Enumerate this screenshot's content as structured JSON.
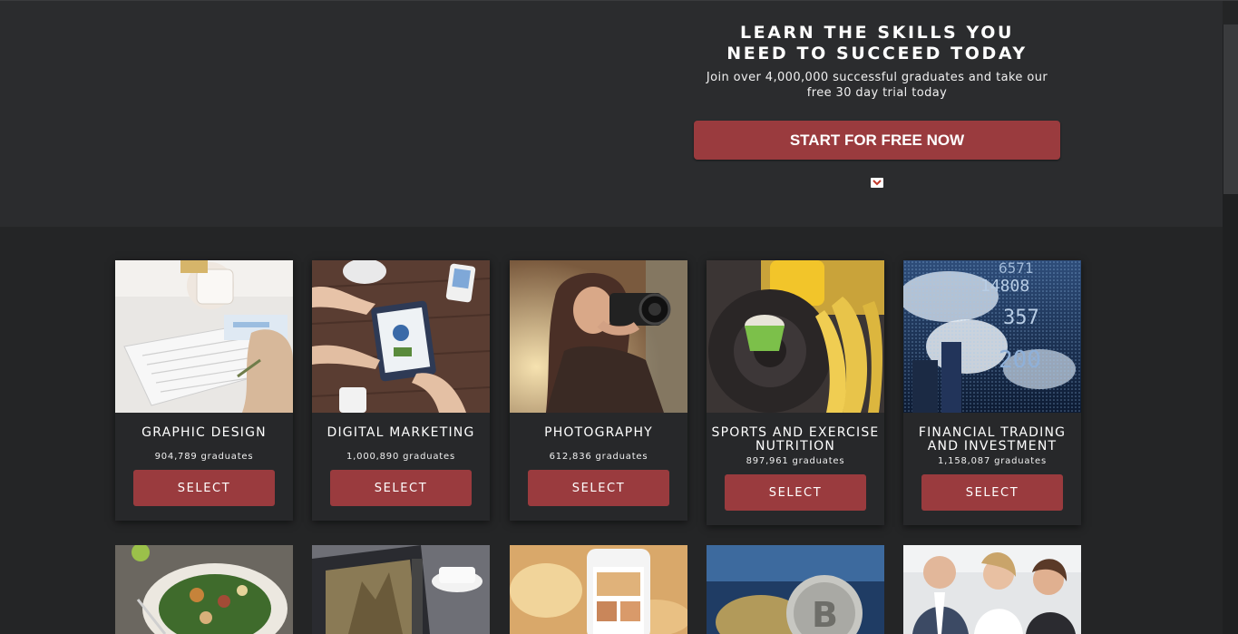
{
  "hero": {
    "title_line1": "LEARN THE SKILLS YOU",
    "title_line2": "NEED TO SUCCEED TODAY",
    "sub_line1": "Join over 4,000,000 successful graduates and take our",
    "sub_line2": "free 30 day trial today",
    "cta_label": "START FOR FREE NOW",
    "scroll_icon": "chevron-down-icon"
  },
  "colors": {
    "accent": "#9a3b3e",
    "page_bg": "#242526",
    "hero_bg": "#2b2c2e",
    "card_bg": "#27282a"
  },
  "courses": [
    {
      "title_line1": "GRAPHIC DESIGN",
      "title_line2": "",
      "graduates": "904,789 graduates",
      "select_label": "SELECT"
    },
    {
      "title_line1": "DIGITAL MARKETING",
      "title_line2": "",
      "graduates": "1,000,890 graduates",
      "select_label": "SELECT"
    },
    {
      "title_line1": "PHOTOGRAPHY",
      "title_line2": "",
      "graduates": "612,836 graduates",
      "select_label": "SELECT"
    },
    {
      "title_line1": "SPORTS AND EXERCISE",
      "title_line2": "NUTRITION",
      "graduates": "897,961 graduates",
      "select_label": "SELECT"
    },
    {
      "title_line1": "FINANCIAL TRADING",
      "title_line2": "AND INVESTMENT",
      "graduates": "1,158,087 graduates",
      "select_label": "SELECT"
    }
  ]
}
